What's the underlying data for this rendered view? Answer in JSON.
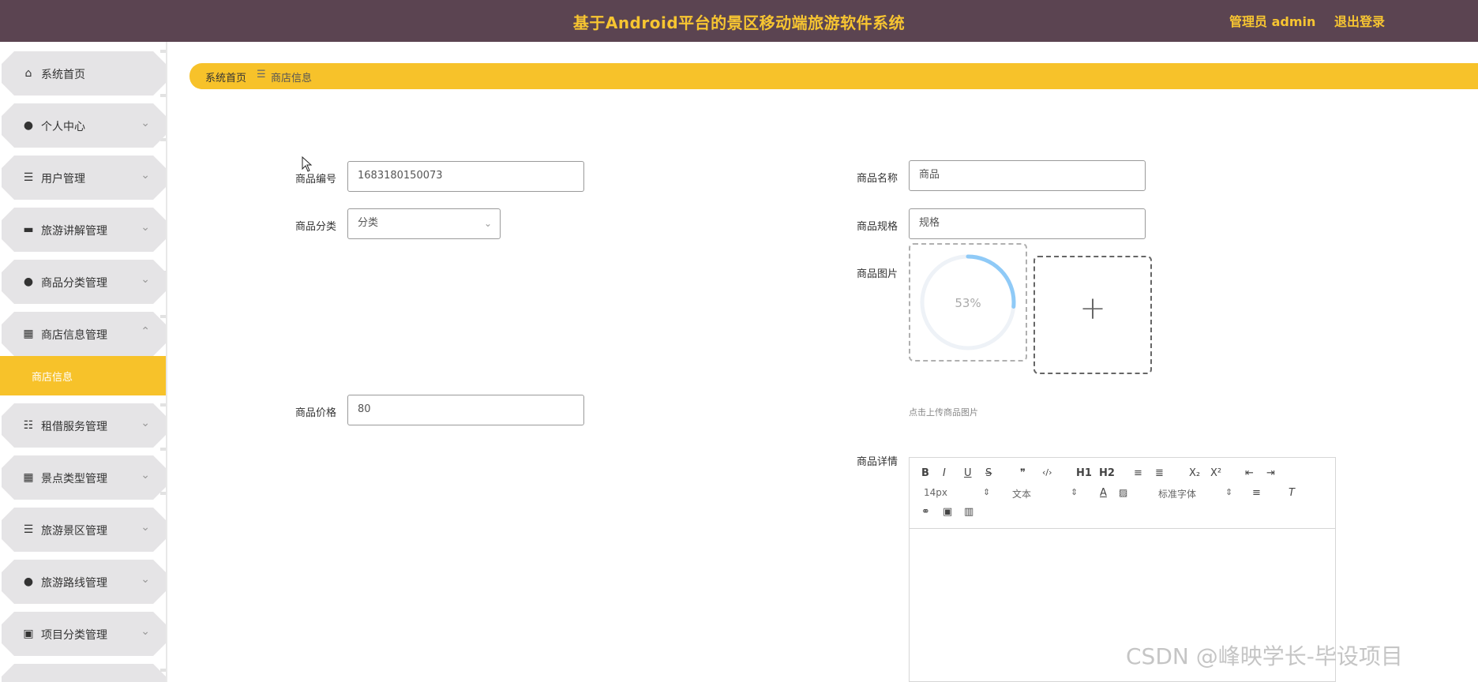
{
  "header": {
    "title": "基于Android平台的景区移动端旅游软件系统",
    "admin": "管理员 admin",
    "logout": "退出登录"
  },
  "sidebar": {
    "items": [
      {
        "label": "系统首页",
        "icon": "home-icon"
      },
      {
        "label": "个人中心",
        "icon": "user-icon"
      },
      {
        "label": "用户管理",
        "icon": "list-icon"
      },
      {
        "label": "旅游讲解管理",
        "icon": "ticket-icon"
      },
      {
        "label": "商品分类管理",
        "icon": "balloon-icon"
      },
      {
        "label": "商店信息管理",
        "icon": "grid-icon"
      },
      {
        "label": "租借服务管理",
        "icon": "sliders-icon"
      },
      {
        "label": "景点类型管理",
        "icon": "grid-icon"
      },
      {
        "label": "旅游景区管理",
        "icon": "list-icon"
      },
      {
        "label": "旅游路线管理",
        "icon": "user-icon"
      },
      {
        "label": "项目分类管理",
        "icon": "clipboard-icon"
      }
    ],
    "active_sub": "商店信息"
  },
  "breadcrumb": {
    "home": "系统首页",
    "sep": "☰",
    "current": "商店信息"
  },
  "form": {
    "code_label": "商品编号",
    "code_value": "1683180150073",
    "category_label": "商品分类",
    "category_value": "分类",
    "price_label": "商品价格",
    "price_value": "80",
    "name_label": "商品名称",
    "name_value": "商品",
    "spec_label": "商品规格",
    "spec_value": "规格",
    "image_label": "商品图片",
    "upload_progress": 0.53,
    "upload_progress_text": "53%",
    "upload_hint": "点击上传商品图片",
    "detail_label": "商品详情"
  },
  "editor": {
    "font_size": "14px",
    "block": "文本",
    "font_family": "标准字体",
    "buttons": [
      "B",
      "I",
      "U",
      "S",
      "❞",
      "‹/›",
      "H1",
      "H2",
      "≡",
      "≣",
      "X₂",
      "X²",
      "⇤",
      "⇥"
    ]
  },
  "watermark": "CSDN @峰映学长-毕设项目"
}
